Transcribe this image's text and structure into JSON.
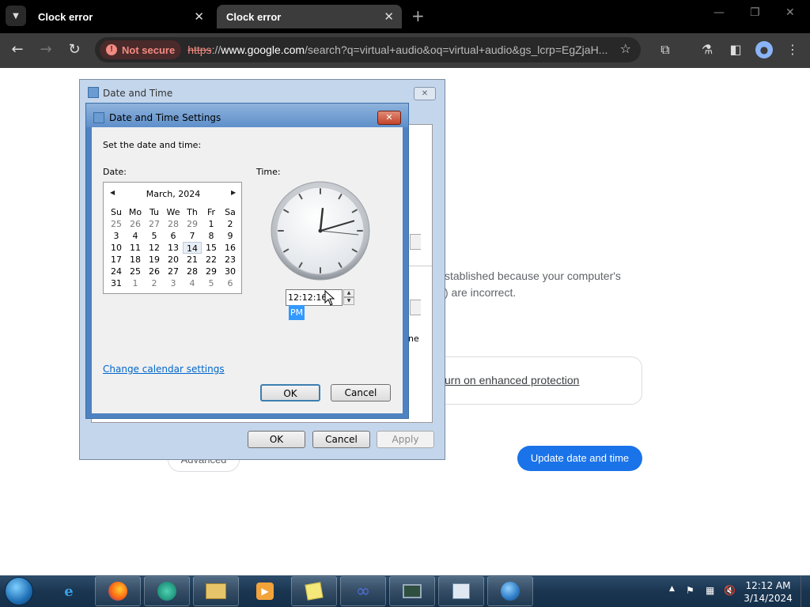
{
  "browser": {
    "tabs": [
      {
        "title": "Clock error",
        "active": false
      },
      {
        "title": "Clock error",
        "active": true
      }
    ],
    "security_label": "Not secure",
    "url": {
      "scheme": "https",
      "separator": "://",
      "host": "www.google.com",
      "path": "/search?q=virtual+audio&oq=virtual+audio&gs_lcrp=EgZjaH..."
    }
  },
  "page": {
    "text_line1": "stablished because your computer's",
    "text_line2": ") are incorrect.",
    "protection_link": "urn on enhanced protection",
    "update_button": "Update date and time",
    "advanced_button": "Advanced"
  },
  "outer_dialog": {
    "title": "Date and Time",
    "partial_text": "ne",
    "buttons": {
      "ok": "OK",
      "cancel": "Cancel",
      "apply": "Apply"
    }
  },
  "inner_dialog": {
    "title": "Date and Time Settings",
    "instruction": "Set the date and time:",
    "date_label": "Date:",
    "time_label": "Time:",
    "calendar": {
      "month_year": "March, 2024",
      "weekdays": [
        "Su",
        "Mo",
        "Tu",
        "We",
        "Th",
        "Fr",
        "Sa"
      ],
      "weeks": [
        [
          "25",
          "26",
          "27",
          "28",
          "29",
          "1",
          "2"
        ],
        [
          "3",
          "4",
          "5",
          "6",
          "7",
          "8",
          "9"
        ],
        [
          "10",
          "11",
          "12",
          "13",
          "14",
          "15",
          "16"
        ],
        [
          "17",
          "18",
          "19",
          "20",
          "21",
          "22",
          "23"
        ],
        [
          "24",
          "25",
          "26",
          "27",
          "28",
          "29",
          "30"
        ],
        [
          "31",
          "1",
          "2",
          "3",
          "4",
          "5",
          "6"
        ]
      ],
      "selected_day": "14"
    },
    "time_value": "12:12:16",
    "time_ampm": "PM",
    "clock": {
      "hour": 12,
      "minute": 12,
      "second": 16
    },
    "change_calendar_link": "Change calendar settings",
    "buttons": {
      "ok": "OK",
      "cancel": "Cancel"
    }
  },
  "taskbar": {
    "icons": [
      "windows-start-icon",
      "internet-explorer-icon",
      "firefox-icon",
      "app-icon",
      "file-explorer-icon",
      "media-player-icon",
      "sticky-notes-icon",
      "infinity-app-icon",
      "system-monitor-icon",
      "calendar-clock-icon",
      "network-globe-icon"
    ],
    "clock_time": "12:12 AM",
    "clock_date": "3/14/2024"
  }
}
